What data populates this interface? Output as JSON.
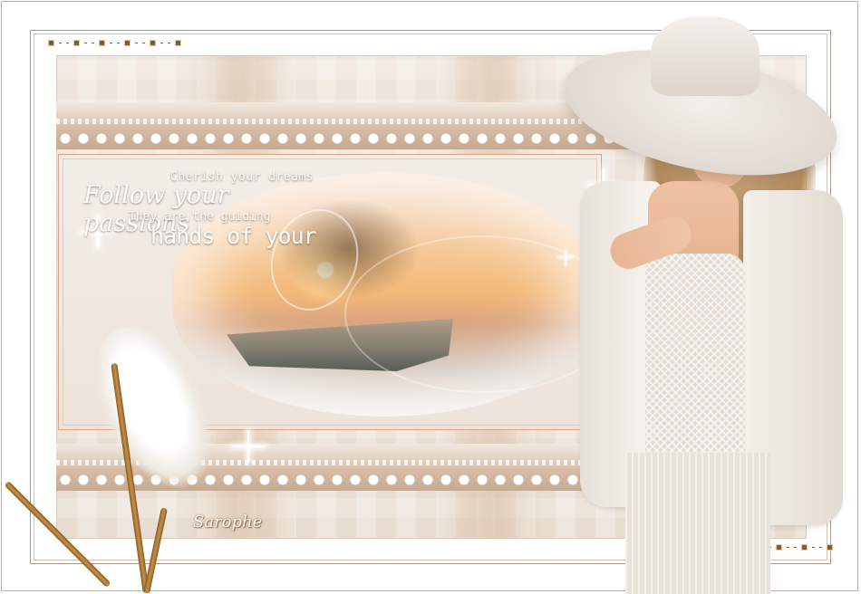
{
  "artwork": {
    "quote_lines": [
      "Cherish your dreams",
      "Follow your passions",
      "They are the guiding",
      "hands of your"
    ],
    "signature": "Sarophe"
  },
  "colors": {
    "background": "#ffffff",
    "panel": "#ece1d6",
    "accent_brown": "#8a5a2b",
    "sunset": "#f2b879",
    "lips": "#d8262b"
  }
}
